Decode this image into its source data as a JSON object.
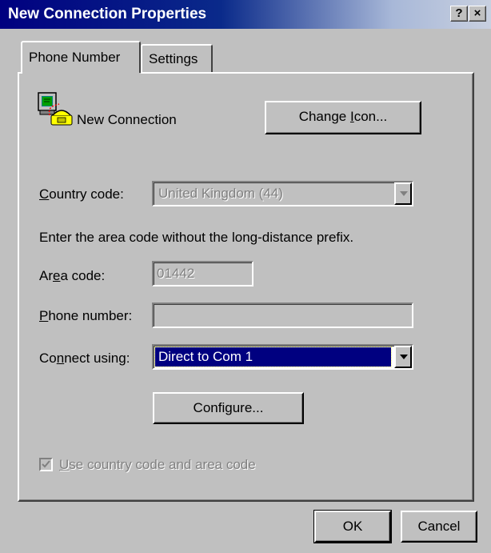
{
  "window": {
    "title": "New Connection Properties",
    "help_button": "?",
    "close_button": "×"
  },
  "tabs": [
    {
      "label": "Phone Number",
      "active": true
    },
    {
      "label": "Settings",
      "active": false
    }
  ],
  "connection": {
    "name": "New Connection",
    "icon": "modem-telephone-icon",
    "change_icon_pre": "Change ",
    "change_icon_mn": "I",
    "change_icon_post": "con..."
  },
  "country": {
    "label_mn": "C",
    "label_post": "ountry code:",
    "value": "United Kingdom (44)",
    "enabled": false
  },
  "instruction": "Enter the area code without the long-distance prefix.",
  "area": {
    "label_pre": "Ar",
    "label_mn": "e",
    "label_post": "a code:",
    "value": "01442",
    "enabled": false
  },
  "phone": {
    "label_mn": "P",
    "label_post": "hone number:",
    "value": "",
    "enabled": false
  },
  "connect": {
    "label_pre": "Co",
    "label_mn": "n",
    "label_post": "nect using:",
    "value": "Direct to Com 1",
    "enabled": true
  },
  "configure": {
    "pre": "Confi",
    "mn": "g",
    "post": "ure..."
  },
  "use_codes": {
    "label_mn": "U",
    "label_post": "se country code and area code",
    "checked": true,
    "enabled": false
  },
  "buttons": {
    "ok": "OK",
    "cancel": "Cancel"
  },
  "colors": {
    "face": "#c0c0c0",
    "titlebar": "#000080",
    "selection": "#000080",
    "disabled_text": "#808080"
  }
}
